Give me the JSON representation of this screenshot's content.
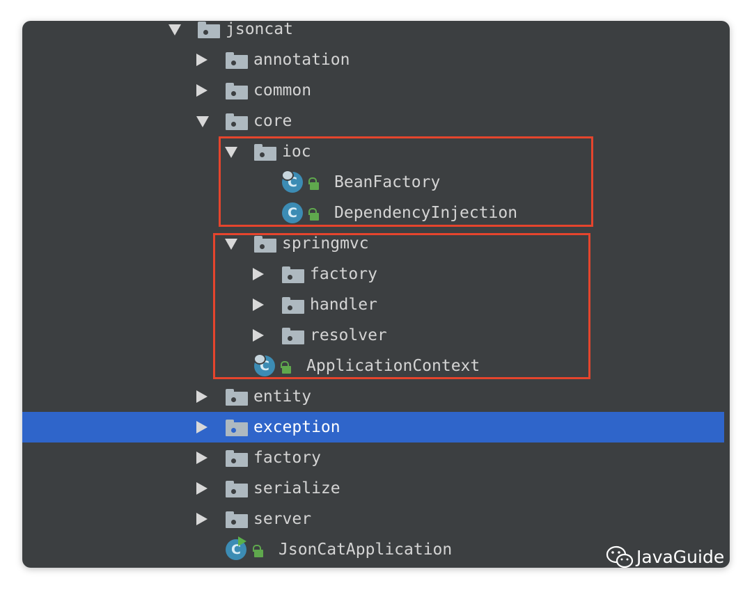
{
  "tree": {
    "root": "jsoncat",
    "annotation": "annotation",
    "common": "common",
    "core": "core",
    "ioc": "ioc",
    "bean_factory": "BeanFactory",
    "dependency_injection": "DependencyInjection",
    "springmvc": "springmvc",
    "factory_sub": "factory",
    "handler": "handler",
    "resolver": "resolver",
    "application_context": "ApplicationContext",
    "entity": "entity",
    "exception": "exception",
    "factory": "factory",
    "serialize": "serialize",
    "server": "server",
    "json_cat_application": "JsonCatApplication"
  },
  "class_icon_letter": "C",
  "watermark": {
    "text": "JavaGuide"
  },
  "colors": {
    "panel_bg": "#3c3f41",
    "selection": "#2f65ca",
    "highlight_box": "#e5452d",
    "folder": "#aeb9c0",
    "class_icon": "#3c8cb4",
    "lock": "#5fa84d"
  }
}
